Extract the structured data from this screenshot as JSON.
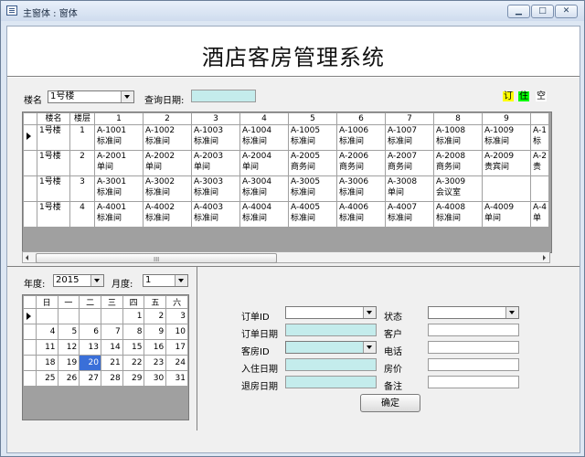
{
  "window": {
    "title": "主窗体 : 窗体",
    "controls": {
      "min": "▁",
      "max": "□",
      "close": "✕"
    }
  },
  "app_title": "酒店客房管理系统",
  "filter": {
    "building_label": "楼名",
    "building_value": "1号楼",
    "query_date_label": "查询日期:",
    "query_date_value": ""
  },
  "legend": [
    {
      "label": "订",
      "color": "#ffff00"
    },
    {
      "label": "住",
      "color": "#00ff00"
    },
    {
      "label": "空",
      "color": "#ffffff"
    }
  ],
  "grid": {
    "headers": [
      "",
      "楼名",
      "楼层",
      "1",
      "2",
      "3",
      "4",
      "5",
      "6",
      "7",
      "8",
      "9",
      ""
    ],
    "rows": [
      {
        "building": "1号楼",
        "floor": "1",
        "rooms": [
          [
            "A-1001",
            "标准间"
          ],
          [
            "A-1002",
            "标准间"
          ],
          [
            "A-1003",
            "标准间"
          ],
          [
            "A-1004",
            "标准间"
          ],
          [
            "A-1005",
            "标准间"
          ],
          [
            "A-1006",
            "标准间"
          ],
          [
            "A-1007",
            "标准间"
          ],
          [
            "A-1008",
            "标准间"
          ],
          [
            "A-1009",
            "标准间"
          ],
          [
            "A-1",
            "标"
          ]
        ]
      },
      {
        "building": "1号楼",
        "floor": "2",
        "rooms": [
          [
            "A-2001",
            "单间"
          ],
          [
            "A-2002",
            "单间"
          ],
          [
            "A-2003",
            "单间"
          ],
          [
            "A-2004",
            "单间"
          ],
          [
            "A-2005",
            "商务间"
          ],
          [
            "A-2006",
            "商务间"
          ],
          [
            "A-2007",
            "商务间"
          ],
          [
            "A-2008",
            "商务间"
          ],
          [
            "A-2009",
            "贵宾间"
          ],
          [
            "A-2",
            "贵"
          ]
        ]
      },
      {
        "building": "1号楼",
        "floor": "3",
        "rooms": [
          [
            "A-3001",
            "标准间"
          ],
          [
            "A-3002",
            "标准间"
          ],
          [
            "A-3003",
            "标准间"
          ],
          [
            "A-3004",
            "标准间"
          ],
          [
            "A-3005",
            "标准间"
          ],
          [
            "A-3006",
            "标准间"
          ],
          [
            "A-3008",
            "单间"
          ],
          [
            "A-3009",
            "会议室"
          ],
          [
            "",
            ""
          ],
          [
            "",
            ""
          ]
        ]
      },
      {
        "building": "1号楼",
        "floor": "4",
        "rooms": [
          [
            "A-4001",
            "标准间"
          ],
          [
            "A-4002",
            "标准间"
          ],
          [
            "A-4003",
            "标准间"
          ],
          [
            "A-4004",
            "标准间"
          ],
          [
            "A-4005",
            "标准间"
          ],
          [
            "A-4006",
            "标准间"
          ],
          [
            "A-4007",
            "标准间"
          ],
          [
            "A-4008",
            "标准间"
          ],
          [
            "A-4009",
            "单间"
          ],
          [
            "A-4",
            "单"
          ]
        ]
      }
    ],
    "scroll_grip": "III"
  },
  "calendar": {
    "year_label": "年度:",
    "year_value": "2015",
    "month_label": "月度:",
    "month_value": "1",
    "weekdays": [
      "日",
      "一",
      "二",
      "三",
      "四",
      "五",
      "六"
    ],
    "weeks": [
      [
        "",
        "",
        "",
        "",
        "1",
        "2",
        "3"
      ],
      [
        "4",
        "5",
        "6",
        "7",
        "8",
        "9",
        "10"
      ],
      [
        "11",
        "12",
        "13",
        "14",
        "15",
        "16",
        "17"
      ],
      [
        "18",
        "19",
        "20",
        "21",
        "22",
        "23",
        "24"
      ],
      [
        "25",
        "26",
        "27",
        "28",
        "29",
        "30",
        "31"
      ]
    ],
    "today": "20"
  },
  "order_form": {
    "order_id_label": "订单ID",
    "order_date_label": "订单日期",
    "room_id_label": "客房ID",
    "checkin_label": "入住日期",
    "checkout_label": "退房日期",
    "status_label": "状态",
    "customer_label": "客户",
    "phone_label": "电话",
    "price_label": "房价",
    "note_label": "备注",
    "confirm_label": "确定"
  }
}
